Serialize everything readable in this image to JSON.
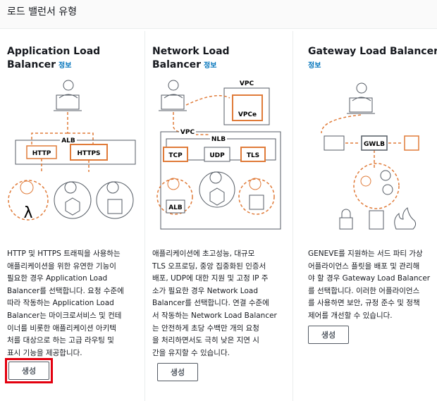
{
  "header": {
    "title": "로드 밸런서 유형"
  },
  "cards": [
    {
      "title_lines": [
        "Application Load",
        "Balancer"
      ],
      "info": "정보",
      "diagram_labels": {
        "alb": "ALB",
        "http": "HTTP",
        "https": "HTTPS"
      },
      "desc": [
        "HTTP 및 HTTPS 트래픽을 사용하는",
        "애플리케이션을 위한 유연한 기능이",
        "필요한 경우 Application Load",
        "Balancer를 선택합니다. 요청 수준에",
        "따라 작동하는 Application Load",
        "Balancer는 마이크로서비스 및 컨테",
        "이너를 비롯한 애플리케이션 아키텍",
        "처를 대상으로 하는 고급 라우팅 및",
        "표시 기능을 제공합니다."
      ],
      "button": "생성"
    },
    {
      "title_lines": [
        "Network Load Balancer"
      ],
      "info": "정보",
      "diagram_labels": {
        "vpc_top": "VPC",
        "vpce": "VPCe",
        "vpc": "VPC",
        "nlb": "NLB",
        "tcp": "TCP",
        "udp": "UDP",
        "tls": "TLS",
        "alb": "ALB"
      },
      "desc": [
        "애플리케이션에 초고성능, 대규모",
        "TLS 오프로딩, 중앙 집중화된 인증서",
        "배포, UDP에 대한 지원 및 고정 IP 주",
        "소가 필요한 경우 Network Load",
        "Balancer를 선택합니다. 연결 수준에",
        "서 작동하는 Network Load Balancer",
        "는 안전하게 초당 수백만 개의 요청",
        "을 처리하면서도 극히 낮은 지연 시",
        "간을 유지할 수 있습니다."
      ],
      "button": "생성"
    },
    {
      "title_lines": [
        "Gateway Load Balancer"
      ],
      "info": "정보",
      "diagram_labels": {
        "gwlb": "GWLB"
      },
      "desc": [
        "GENEVE를 지원하는 서드 파티 가상",
        "어플라이언스 플릿을 배포 및 관리해",
        "야 할 경우 Gateway Load Balancer",
        "를 선택합니다. 이러한 어플라이언스",
        "를 사용하면 보안, 규정 준수 및 정책",
        "제어를 개선할 수 있습니다."
      ],
      "button": "생성"
    }
  ],
  "colors": {
    "accent": "#e07b39",
    "info": "#0073bb",
    "highlight": "#e3000f"
  }
}
